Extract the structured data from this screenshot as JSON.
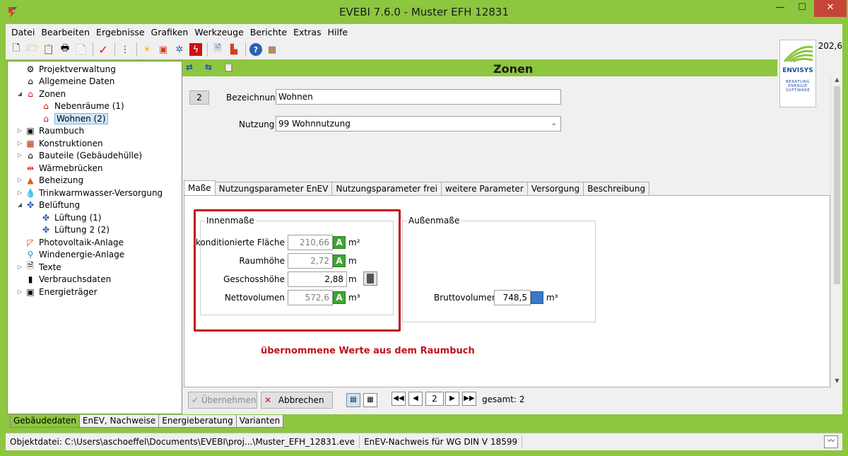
{
  "window": {
    "title": "EVEBI 7.6.0 - Muster EFH 12831",
    "min": "—",
    "max": "☐",
    "close": "✕"
  },
  "menu": [
    "Datei",
    "Bearbeiten",
    "Ergebnisse",
    "Grafiken",
    "Werkzeuge",
    "Berichte",
    "Extras",
    "Hilfe"
  ],
  "toolbar_right_value": "202,6",
  "logo": {
    "brand": "ENVISYS",
    "tagline": "BERATUNG ENERGIE SOFTWARE"
  },
  "tree": [
    {
      "label": "Projektverwaltung",
      "icon": "project-icon",
      "level": 1
    },
    {
      "label": "Allgemeine Daten",
      "icon": "house-info-icon",
      "level": 1
    },
    {
      "label": "Zonen",
      "icon": "zones-house-icon",
      "level": 1,
      "expanded": true
    },
    {
      "label": "Nebenräume (1)",
      "icon": "zone-house-icon",
      "level": 2
    },
    {
      "label": "Wohnen (2)",
      "icon": "zone-house-icon",
      "level": 2,
      "selected": true
    },
    {
      "label": "Raumbuch",
      "icon": "room-book-icon",
      "level": 1
    },
    {
      "label": "Konstruktionen",
      "icon": "construction-icon",
      "level": 1
    },
    {
      "label": "Bauteile (Gebäudehülle)",
      "icon": "building-parts-icon",
      "level": 1
    },
    {
      "label": "Wärmebrücken",
      "icon": "thermal-bridge-icon",
      "level": 1
    },
    {
      "label": "Beheizung",
      "icon": "heating-icon",
      "level": 1
    },
    {
      "label": "Trinkwarmwasser-Versorgung",
      "icon": "water-drop-icon",
      "level": 1
    },
    {
      "label": "Belüftung",
      "icon": "ventilation-fan-icon",
      "level": 1,
      "expanded": true
    },
    {
      "label": "Lüftung (1)",
      "icon": "fan-icon",
      "level": 2
    },
    {
      "label": "Lüftung 2 (2)",
      "icon": "fan-icon",
      "level": 2
    },
    {
      "label": "Photovoltaik-Anlage",
      "icon": "solar-icon",
      "level": 1
    },
    {
      "label": "Windenergie-Anlage",
      "icon": "wind-turbine-icon",
      "level": 1
    },
    {
      "label": "Texte",
      "icon": "text-doc-icon",
      "level": 1
    },
    {
      "label": "Verbrauchsdaten",
      "icon": "consumption-icon",
      "level": 1
    },
    {
      "label": "Energieträger",
      "icon": "energy-carrier-icon",
      "level": 1
    }
  ],
  "panel": {
    "title": "Zonen",
    "zone_number": "2",
    "bezeichnung_label": "Bezeichnung",
    "bezeichnung_value": "Wohnen",
    "nutzung_label": "Nutzung",
    "nutzung_value": "99 Wohnnutzung"
  },
  "tabs": [
    "Maße",
    "Nutzungsparameter EnEV",
    "Nutzungsparameter frei",
    "weitere Parameter",
    "Versorgung",
    "Beschreibung"
  ],
  "innenmasse": {
    "title": "Innenmaße",
    "rows": [
      {
        "label": "konditionierte Fläche",
        "value": "210,66",
        "unit": "m²"
      },
      {
        "label": "Raumhöhe",
        "value": "2,72",
        "unit": "m"
      },
      {
        "label": "Geschosshöhe",
        "value": "2,88",
        "unit": "m"
      },
      {
        "label": "Nettovolumen",
        "value": "572,6",
        "unit": "m³"
      }
    ]
  },
  "aussenmasse": {
    "title": "Außenmaße",
    "brutto_label": "Bruttovolumen",
    "brutto_value": "748,5",
    "brutto_unit": "m³"
  },
  "note": "übernommene Werte aus dem Raumbuch",
  "actions": {
    "apply": "Übernehmen",
    "cancel": "Abbrechen"
  },
  "pager": {
    "current": "2",
    "total_label": "gesamt: 2"
  },
  "bottom_tabs": [
    "Gebäudedaten",
    "EnEV, Nachweise",
    "Energieberatung",
    "Varianten"
  ],
  "status": {
    "file": "Objektdatei: C:\\Users\\aschoeffel\\Documents\\EVEBI\\proj...\\Muster_EFH_12831.eve",
    "mode": "EnEV-Nachweis für WG DIN V 18599"
  }
}
